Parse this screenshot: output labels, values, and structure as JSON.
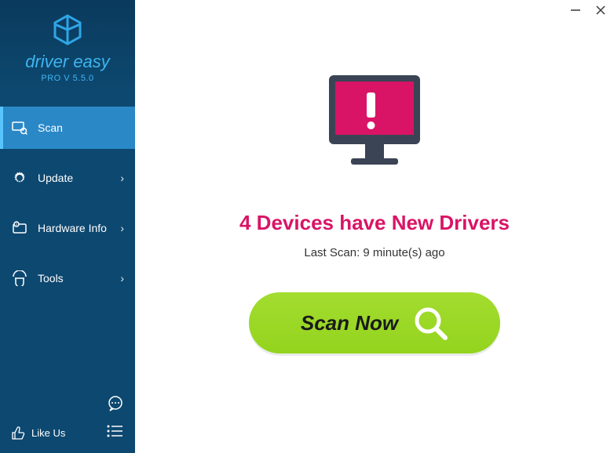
{
  "brand": {
    "name": "driver easy",
    "version": "PRO V 5.5.0"
  },
  "nav": {
    "scan": "Scan",
    "update": "Update",
    "hardware": "Hardware Info",
    "tools": "Tools"
  },
  "footer": {
    "like": "Like Us"
  },
  "main": {
    "headline": "4 Devices have New Drivers",
    "last_scan": "Last Scan: 9 minute(s) ago",
    "scan_button": "Scan Now"
  },
  "colors": {
    "accent": "#d91466",
    "green": "#97d621",
    "sidebar": "#0d4870"
  }
}
